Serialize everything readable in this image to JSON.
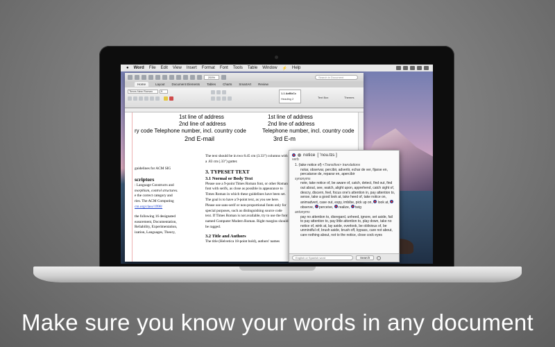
{
  "menubar": {
    "app": "Word",
    "items": [
      "File",
      "Edit",
      "View",
      "Insert",
      "Format",
      "Font",
      "Tools",
      "Table",
      "Window",
      "Help"
    ]
  },
  "toolbar": {
    "zoom": "200%",
    "search_placeholder": "Search in Document"
  },
  "ribbon": {
    "tabs": [
      "Home",
      "Layout",
      "Document Elements",
      "Tables",
      "Charts",
      "SmartArt",
      "Review"
    ],
    "font_name": "Times New Roman",
    "font_size": "9",
    "styles_sample": "1.1 AaBbCc",
    "styles_name": "Heading 2",
    "textbox_label": "Text Box",
    "themes_label": "Themes"
  },
  "document": {
    "address_lines": [
      "1st line of address",
      "2nd line of address",
      "ry code Telephone number, incl. country code",
      "2nd E-mail",
      "1st line of address",
      "2nd line of address",
      "Telephone number, incl. country code",
      "3rd E-m"
    ],
    "left_col": [
      "guidelines for ACM SIG",
      "scriptors",
      ": Language Constructs and",
      "morphism, control structures.",
      "e the correct category and",
      "ries. The ACM Computing",
      "cm.org/class/1998/",
      "the following 16 designated",
      "easurement, Documentation,",
      "Reliability, Experimentation,",
      "ization, Languages, Theory,"
    ],
    "right_col": {
      "intro": "The text should be in two 8.45 cm (3.33\") columns with a .83 cm (.33\") gutter.",
      "h1": "3.  TYPESET TEXT",
      "h2a": "3.1  Normal or Body Text",
      "body": "Please use a 9-point Times Roman font, or other Roman font with serifs, as close as possible in appearance to Times Roman in which these guidelines have been set. The goal is to have a 9-point text, as you see here. Please use sans-serif or non-proportional fonts only for special purposes, such as distinguishing source code text. If Times Roman is not available, try to use the font named Computer Modern Roman. Right margins should be ragged.",
      "h2b": "3.2  Title and Authors",
      "tail": "The title (Helvetica 18-point bold), authors' names"
    }
  },
  "dictionary": {
    "word": "notice",
    "pron": "[ 'nou.tɪs ]",
    "pos": "verb",
    "sense": "1.  (take notice of)",
    "sense_tag": "<Transitive>",
    "sense_tag2": "translations",
    "translations": "notar, observar, percibir, advertir, echar de ver, fijarse en, percatarse de, reparar en, apercibir",
    "synonyms_label": "synonyms",
    "synonyms": "note, take notice of, be aware of, catch, detect, find out, find out about, see, watch, alight upon, apprehend, catch sight of, descry, discern, feel, focus one's attention in, pay attention to, sense, take a good look at, take heed of, take notice on, animadvert, case out, espy, imbibe, pick up on,",
    "syn_extra": [
      "look at,",
      "observe,",
      "perceive,",
      "realize,",
      "twig"
    ],
    "antonyms_label": "antonyms",
    "antonyms": "pay no attention to, disregard, unheed, ignore, set aside, fail to pay attention to, pay little attention to, play down, take no notice of, wink at, lay aside, overlook, be oblivious of, be unmindful of, brush aside, brush off, bypass, care not about, care nothing about, not to the notice, close cock eyes",
    "search_placeholder": "English or Spanish word",
    "search_button": "Search"
  },
  "tagline": "Make sure you know your words in any document"
}
